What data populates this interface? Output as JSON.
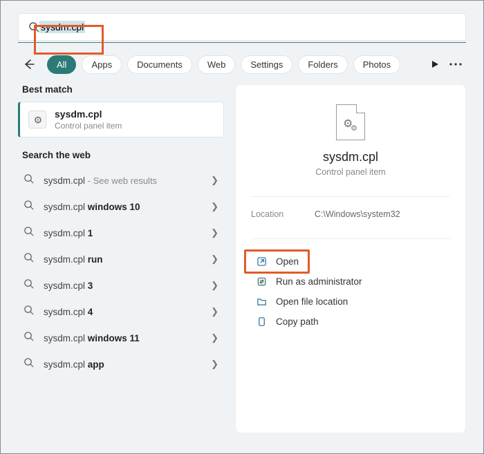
{
  "search": {
    "query": "sysdm.cpl",
    "placeholder": ""
  },
  "tabs": [
    "All",
    "Apps",
    "Documents",
    "Web",
    "Settings",
    "Folders",
    "Photos"
  ],
  "active_tab": 0,
  "left": {
    "best_match_heading": "Best match",
    "best": {
      "name": "sysdm.cpl",
      "kind": "Control panel item"
    },
    "web_heading": "Search the web",
    "web_results": [
      {
        "prefix": "sysdm.cpl",
        "bold": "",
        "hint": " - See web results"
      },
      {
        "prefix": "sysdm.cpl ",
        "bold": "windows 10",
        "hint": ""
      },
      {
        "prefix": "sysdm.cpl ",
        "bold": "1",
        "hint": ""
      },
      {
        "prefix": "sysdm.cpl ",
        "bold": "run",
        "hint": ""
      },
      {
        "prefix": "sysdm.cpl ",
        "bold": "3",
        "hint": ""
      },
      {
        "prefix": "sysdm.cpl ",
        "bold": "4",
        "hint": ""
      },
      {
        "prefix": "sysdm.cpl ",
        "bold": "windows 11",
        "hint": ""
      },
      {
        "prefix": "sysdm.cpl ",
        "bold": "app",
        "hint": ""
      }
    ]
  },
  "detail": {
    "name": "sysdm.cpl",
    "kind": "Control panel item",
    "meta_key": "Location",
    "meta_val": "C:\\Windows\\system32",
    "actions": [
      {
        "id": "open",
        "icon": "open",
        "label": "Open"
      },
      {
        "id": "admin",
        "icon": "shield",
        "label": "Run as administrator"
      },
      {
        "id": "loc",
        "icon": "folder",
        "label": "Open file location"
      },
      {
        "id": "copy",
        "icon": "copy",
        "label": "Copy path"
      }
    ]
  }
}
